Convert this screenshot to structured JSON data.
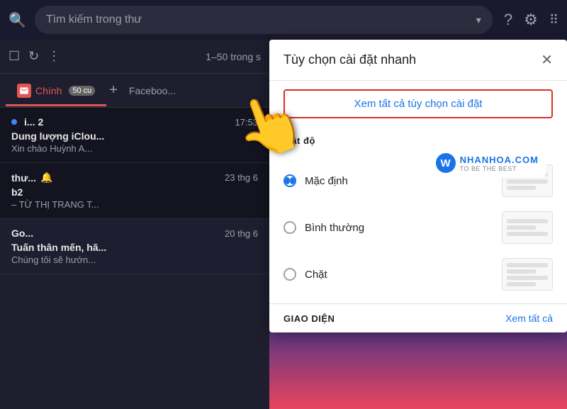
{
  "header": {
    "search_placeholder": "Tìm kiếm trong thư",
    "search_text": "Tìm kiếm trong thư",
    "help_icon": "?",
    "settings_icon": "⚙",
    "apps_icon": "⋮⋮"
  },
  "toolbar": {
    "count_text": "1–50 trong s",
    "checkbox_icon": "☐",
    "refresh_icon": "↻",
    "more_icon": "⋮"
  },
  "tabs": [
    {
      "label": "Chính",
      "icon": "inbox",
      "active": true,
      "badge": "50 cu"
    },
    {
      "label": "Faceboo...",
      "active": false
    }
  ],
  "emails": [
    {
      "sender": "i... 2",
      "time": "17:53",
      "subject": "Dung lượng iClou...",
      "preview": "Xin chào Huỳnh A...",
      "unread": true
    },
    {
      "sender": "thư...",
      "time": "23 thg 6",
      "subject": "b2",
      "preview": "– TỪ THỊ TRANG T...",
      "unread": false,
      "has_snooze": true
    },
    {
      "sender": "Go...",
      "time": "20 thg 6",
      "subject": "Tuấn thân mến, hã...",
      "preview": "Chúng tôi sẽ hướn...",
      "unread": false
    }
  ],
  "settings_panel": {
    "title": "Tùy chọn cài đặt nhanh",
    "close_icon": "✕",
    "view_all_link": "Xem tất cả tùy chọn cài đặt",
    "density_label": "Mật độ",
    "density_options": [
      {
        "label": "Mặc định",
        "selected": true
      },
      {
        "label": "Bình thường",
        "selected": false
      },
      {
        "label": "Chặt",
        "selected": false
      }
    ],
    "footer_section": "GIAO DIỆN",
    "footer_link": "Xem tất cả"
  },
  "watermark": {
    "letter": "W",
    "name": "NHANHOA.COM",
    "tagline": "TO BE THE BEST"
  }
}
